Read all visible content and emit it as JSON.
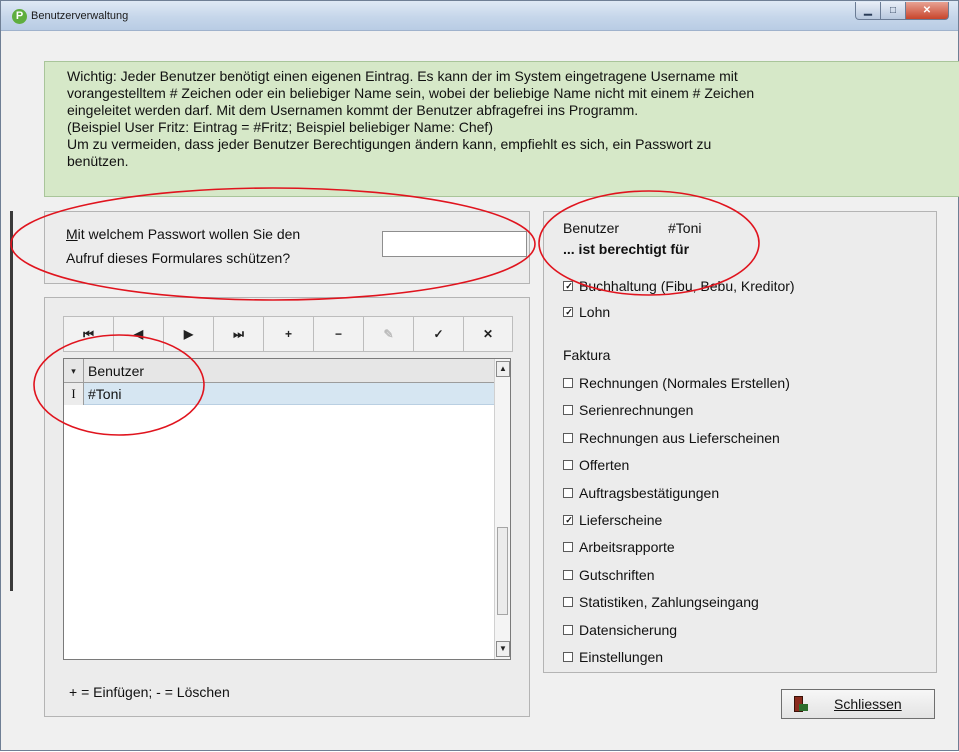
{
  "window": {
    "title": "Benutzerverwaltung",
    "app_icon_letter": "P",
    "buttons": {
      "minimize": "▁",
      "maximize": "□",
      "close": "✕"
    }
  },
  "info": {
    "lines": [
      "Wichtig: Jeder Benutzer benötigt einen eigenen Eintrag. Es kann der im System eingetragene Username mit",
      "vorangestelltem # Zeichen oder ein beliebiger Name sein, wobei der beliebige Name nicht mit einem # Zeichen",
      "eingeleitet werden darf. Mit dem Usernamen kommt der Benutzer abfragefrei ins Programm.",
      "(Beispiel User Fritz: Eintrag =  #Fritz; Beispiel beliebiger Name: Chef)",
      "Um zu vermeiden, dass jeder Benutzer Berechtigungen ändern kann, empfiehlt es sich, ein Passwort zu",
      "benützen."
    ]
  },
  "password": {
    "label_line1_accel": "M",
    "label_line1_rest": "it welchem Passwort wollen Sie den",
    "label_line2": "Aufruf dieses Formulares schützen?",
    "value": ""
  },
  "navigator": {
    "buttons": [
      {
        "name": "first-record-button",
        "glyph": "⏮",
        "enabled": true
      },
      {
        "name": "prev-record-button",
        "glyph": "◀",
        "enabled": true
      },
      {
        "name": "next-record-button",
        "glyph": "▶",
        "enabled": true
      },
      {
        "name": "last-record-button",
        "glyph": "⏭",
        "enabled": true
      },
      {
        "name": "insert-record-button",
        "glyph": "+",
        "enabled": true
      },
      {
        "name": "delete-record-button",
        "glyph": "−",
        "enabled": true
      },
      {
        "name": "edit-record-button",
        "glyph": "✎",
        "enabled": false
      },
      {
        "name": "post-record-button",
        "glyph": "✓",
        "enabled": true
      },
      {
        "name": "cancel-record-button",
        "glyph": "✕",
        "enabled": true
      }
    ]
  },
  "grid": {
    "header_indicator": "▾",
    "column_header": "Benutzer",
    "rows": [
      {
        "indicator": "I",
        "value": "#Toni"
      }
    ],
    "scroll_up": "▲",
    "scroll_down": "▼"
  },
  "hint": "+ = Einfügen; - = Löschen",
  "rights": {
    "heading": "Benutzer",
    "user": "#Toni",
    "subheading": "... ist berechtigt für",
    "items": [
      {
        "label": "Buchhaltung (Fibu, Bebu, Kreditor)",
        "checked": true
      },
      {
        "label": "Lohn",
        "checked": true
      }
    ],
    "group_label": "Faktura",
    "faktura_items": [
      {
        "label": "Rechnungen (Normales Erstellen)",
        "checked": false
      },
      {
        "label": "Serienrechnungen",
        "checked": false
      },
      {
        "label": "Rechnungen aus Lieferscheinen",
        "checked": false
      },
      {
        "label": "Offerten",
        "checked": false
      },
      {
        "label": "Auftragsbestätigungen",
        "checked": false
      },
      {
        "label": "Lieferscheine",
        "checked": true
      },
      {
        "label": "Arbeitsrapporte",
        "checked": false
      },
      {
        "label": "Gutschriften",
        "checked": false
      },
      {
        "label": "Statistiken, Zahlungseingang",
        "checked": false
      },
      {
        "label": "Datensicherung",
        "checked": false
      },
      {
        "label": "Einstellungen",
        "checked": false
      }
    ]
  },
  "close_button": {
    "label": "Schliessen",
    "icon": "exit-door-icon"
  },
  "colors": {
    "info_bg": "#d6e8c8",
    "selected_row": "#d6e6f2",
    "annotation_oval": "#e0141e"
  }
}
